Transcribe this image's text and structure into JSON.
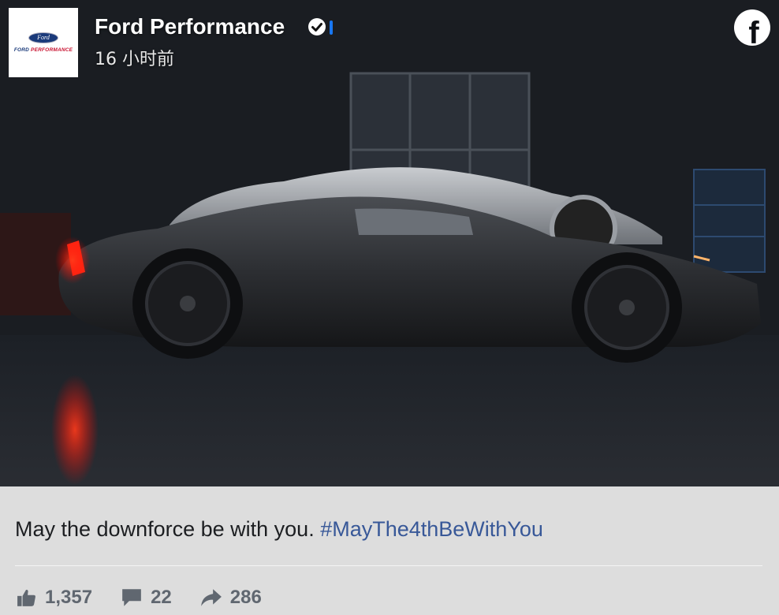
{
  "page": {
    "name": "Ford Performance",
    "timestamp": "16 小时前",
    "avatar": {
      "logo_text": "Ford",
      "brand_text_1": "FORD ",
      "brand_text_2": "PERFORMANCE"
    }
  },
  "post": {
    "text": "May the downforce be with you. ",
    "hashtag": "#MayThe4thBeWithYou"
  },
  "stats": {
    "likes": "1,357",
    "comments": "22",
    "shares": "286"
  },
  "colors": {
    "hashtag": "#385898",
    "verified": "#1877f2",
    "stat_text": "#606770",
    "card_bg": "#dddddd"
  },
  "icons": [
    "verified-badge-icon",
    "facebook-icon",
    "like-icon",
    "comment-icon",
    "share-icon"
  ]
}
